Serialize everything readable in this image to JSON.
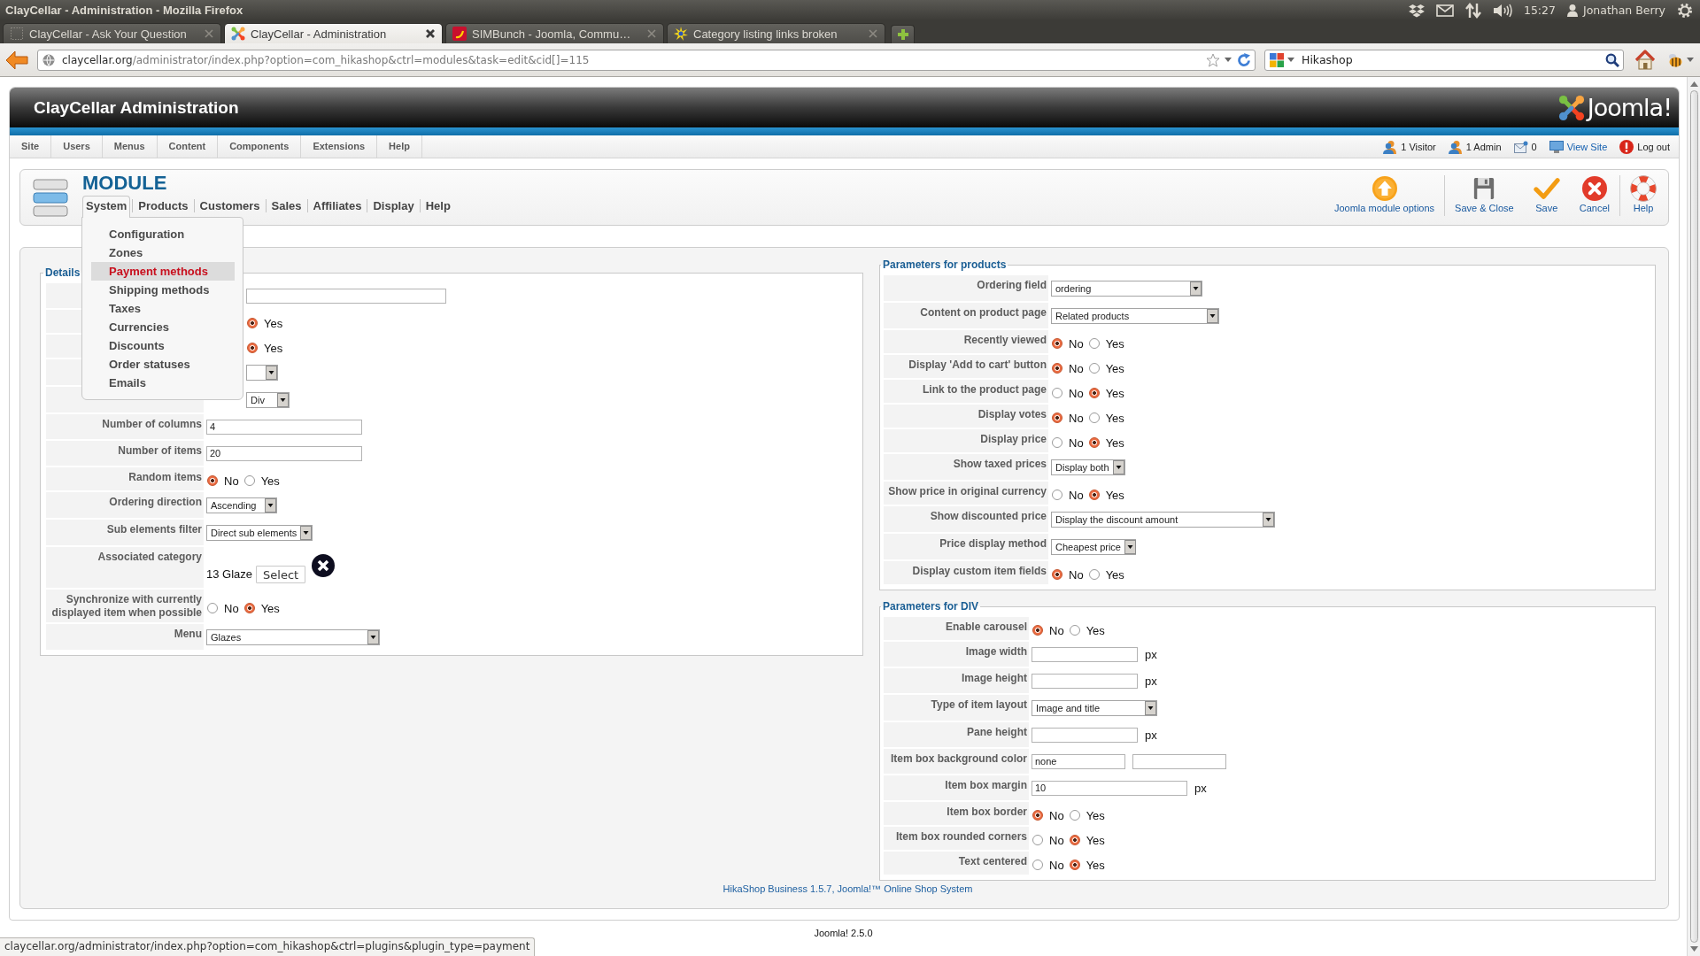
{
  "os_bar": {
    "window_title": "ClayCellar - Administration - Mozilla Firefox",
    "clock": "15:27",
    "user": "Jonathan Berry"
  },
  "browser": {
    "tabs": [
      {
        "title": "ClayCellar - Ask Your Question",
        "selected": false,
        "kind": "blank"
      },
      {
        "title": "ClayCellar - Administration",
        "selected": true,
        "kind": "logo"
      },
      {
        "title": "SIMBunch - Joomla, Commu…",
        "selected": false,
        "kind": "flag"
      },
      {
        "title": "Category listing links broken",
        "selected": false,
        "kind": "burst"
      }
    ],
    "address": {
      "host": "claycellar.org",
      "path": "/administrator/index.php?option=com_hikashop&ctrl=modules&task=edit&cid[]=115"
    },
    "search": {
      "value": "Hikashop"
    }
  },
  "header": {
    "title": "ClayCellar Administration",
    "logo_text": "Joomla!"
  },
  "admin_menu": {
    "items": [
      "Site",
      "Users",
      "Menus",
      "Content",
      "Components",
      "Extensions",
      "Help"
    ],
    "status": [
      {
        "kind": "visitors",
        "label": "1 Visitor"
      },
      {
        "kind": "admins",
        "label": "1 Admin"
      },
      {
        "kind": "messages",
        "label": "0"
      },
      {
        "kind": "view-site",
        "label": "View Site"
      },
      {
        "kind": "logout",
        "label": "Log out"
      }
    ]
  },
  "toolbar": {
    "title": "MODULE",
    "submenu": [
      {
        "label": "System",
        "expanded": true,
        "menu": [
          {
            "label": "Configuration",
            "selected": false
          },
          {
            "label": "Zones",
            "selected": false
          },
          {
            "label": "Payment methods",
            "selected": true
          },
          {
            "label": "Shipping methods",
            "selected": false
          },
          {
            "label": "Taxes",
            "selected": false
          },
          {
            "label": "Currencies",
            "selected": false
          },
          {
            "label": "Discounts",
            "selected": false
          },
          {
            "label": "Order statuses",
            "selected": false
          },
          {
            "label": "Emails",
            "selected": false
          }
        ]
      },
      {
        "label": "Products",
        "expanded": false
      },
      {
        "label": "Customers",
        "expanded": false
      },
      {
        "label": "Sales",
        "expanded": false
      },
      {
        "label": "Affiliates",
        "expanded": false
      },
      {
        "label": "Display",
        "expanded": false
      },
      {
        "label": "Help",
        "expanded": false
      }
    ],
    "buttons": [
      {
        "kind": "options",
        "label": "Joomla module options"
      },
      {
        "kind": "save-close",
        "label": "Save & Close"
      },
      {
        "kind": "save",
        "label": "Save"
      },
      {
        "kind": "cancel",
        "label": "Cancel"
      },
      {
        "kind": "help",
        "label": "Help"
      }
    ]
  },
  "details": {
    "legend": "Details",
    "rows": [
      {
        "kind": "text"
      },
      {
        "kind": "radio",
        "options": [
          {
            "label": "Yes",
            "selected": true
          }
        ]
      },
      {
        "kind": "radio",
        "options": [
          {
            "label": "Yes",
            "selected": true
          }
        ]
      },
      {
        "kind": "select"
      },
      {
        "kind": "select",
        "value": "Div"
      },
      {
        "label": "Number of columns",
        "kind": "text",
        "value": "4"
      },
      {
        "label": "Number of items",
        "kind": "text",
        "value": "20"
      },
      {
        "label": "Random items",
        "kind": "radio",
        "options": [
          {
            "label": "No",
            "selected": true
          },
          {
            "label": "Yes",
            "selected": false
          }
        ]
      },
      {
        "label": "Ordering direction",
        "kind": "select",
        "value": "Ascending"
      },
      {
        "label": "Sub elements filter",
        "kind": "select",
        "value": "Direct sub elements"
      },
      {
        "label": "Associated category",
        "kind": "category",
        "value": "13 Glaze",
        "button": "Select"
      },
      {
        "label": "Synchronize with currently displayed item when possible",
        "kind": "radio",
        "options": [
          {
            "label": "No",
            "selected": false
          },
          {
            "label": "Yes",
            "selected": true
          }
        ]
      },
      {
        "label": "Menu",
        "kind": "select",
        "value": "Glazes"
      }
    ]
  },
  "products": {
    "legend": "Parameters for products",
    "rows": [
      {
        "label": "Ordering field",
        "kind": "select",
        "value": "ordering"
      },
      {
        "label": "Content on product page",
        "kind": "select",
        "value": "Related products"
      },
      {
        "label": "Recently viewed",
        "kind": "radio",
        "options": [
          {
            "label": "No",
            "selected": true
          },
          {
            "label": "Yes",
            "selected": false
          }
        ]
      },
      {
        "label": "Display 'Add to cart' button",
        "kind": "radio",
        "options": [
          {
            "label": "No",
            "selected": true
          },
          {
            "label": "Yes",
            "selected": false
          }
        ]
      },
      {
        "label": "Link to the product page",
        "kind": "radio",
        "options": [
          {
            "label": "No",
            "selected": false
          },
          {
            "label": "Yes",
            "selected": true
          }
        ]
      },
      {
        "label": "Display votes",
        "kind": "radio",
        "options": [
          {
            "label": "No",
            "selected": true
          },
          {
            "label": "Yes",
            "selected": false
          }
        ]
      },
      {
        "label": "Display price",
        "kind": "radio",
        "options": [
          {
            "label": "No",
            "selected": false
          },
          {
            "label": "Yes",
            "selected": true
          }
        ]
      },
      {
        "label": "Show taxed prices",
        "kind": "select",
        "value": "Display both"
      },
      {
        "label": "Show price in original currency",
        "kind": "radio",
        "options": [
          {
            "label": "No",
            "selected": false
          },
          {
            "label": "Yes",
            "selected": true
          }
        ]
      },
      {
        "label": "Show discounted price",
        "kind": "select",
        "value": "Display the discount amount"
      },
      {
        "label": "Price display method",
        "kind": "select",
        "value": "Cheapest price"
      },
      {
        "label": "Display custom item fields",
        "kind": "radio",
        "options": [
          {
            "label": "No",
            "selected": true
          },
          {
            "label": "Yes",
            "selected": false
          }
        ]
      }
    ]
  },
  "div_params": {
    "legend": "Parameters for DIV",
    "rows": [
      {
        "label": "Enable carousel",
        "kind": "radio",
        "options": [
          {
            "label": "No",
            "selected": true
          },
          {
            "label": "Yes",
            "selected": false
          }
        ]
      },
      {
        "label": "Image width",
        "kind": "text",
        "suffix": "px"
      },
      {
        "label": "Image height",
        "kind": "text",
        "suffix": "px"
      },
      {
        "label": "Type of item layout",
        "kind": "select",
        "value": "Image and title"
      },
      {
        "label": "Pane height",
        "kind": "text",
        "suffix": "px"
      },
      {
        "label": "Item box background color",
        "kind": "text-pair",
        "value": "none"
      },
      {
        "label": "Item box margin",
        "kind": "text",
        "value": "10",
        "suffix": "px"
      },
      {
        "label": "Item box border",
        "kind": "radio",
        "options": [
          {
            "label": "No",
            "selected": true
          },
          {
            "label": "Yes",
            "selected": false
          }
        ]
      },
      {
        "label": "Item box rounded corners",
        "kind": "radio",
        "options": [
          {
            "label": "No",
            "selected": false
          },
          {
            "label": "Yes",
            "selected": true
          }
        ]
      },
      {
        "label": "Text centered",
        "kind": "radio",
        "options": [
          {
            "label": "No",
            "selected": false
          },
          {
            "label": "Yes",
            "selected": true
          }
        ]
      }
    ]
  },
  "footer": {
    "credit": "HikaShop Business 1.5.7, Joomla!™ Online Shop System",
    "version": "Joomla! 2.5.0"
  },
  "status_bar": {
    "url": "claycellar.org/administrator/index.php?option=com_hikashop&ctrl=plugins&plugin_type=payment"
  }
}
